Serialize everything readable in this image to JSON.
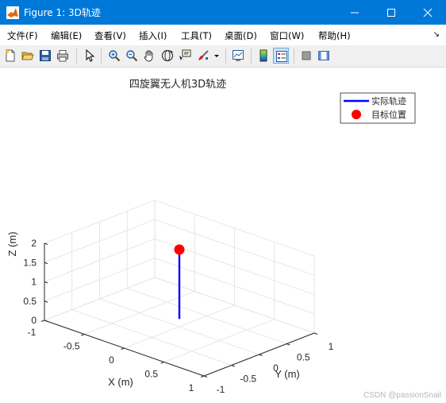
{
  "window": {
    "title": "Figure 1: 3D轨迹",
    "controls": [
      "minimize",
      "maximize",
      "close"
    ]
  },
  "menu": {
    "items": [
      "文件(F)",
      "编辑(E)",
      "查看(V)",
      "插入(I)",
      "工具(T)",
      "桌面(D)",
      "窗口(W)",
      "帮助(H)"
    ],
    "overflow_arrow": "↘"
  },
  "toolbar": {
    "buttons": [
      "new-figure",
      "open-file",
      "save",
      "print",
      "pointer",
      "zoom-in",
      "zoom-out",
      "pan",
      "rotate-3d",
      "data-cursor",
      "brush",
      "link-plot",
      "colorbar",
      "legend",
      "hide-plot-tools",
      "show-plot-tools"
    ],
    "active": "legend"
  },
  "chart_data": {
    "type": "line3d",
    "title": "四旋翼无人机3D轨迹",
    "xlabel": "X (m)",
    "ylabel": "Y (m)",
    "zlabel": "Z (m)",
    "xlim": [
      -1,
      1
    ],
    "ylim": [
      -1,
      1
    ],
    "zlim": [
      0,
      2
    ],
    "x_ticks": [
      "-1",
      "-0.5",
      "0",
      "0.5",
      "1"
    ],
    "y_ticks": [
      "-1",
      "-0.5",
      "0",
      "0.5",
      "1"
    ],
    "z_ticks": [
      "0",
      "0.5",
      "1",
      "1.5",
      "2"
    ],
    "grid": true,
    "legend_position": "top-right",
    "series": [
      {
        "name": "实际轨迹",
        "kind": "line",
        "color": "#0000ff",
        "x": [
          0,
          0
        ],
        "y": [
          0,
          0
        ],
        "z": [
          0.2,
          2.0
        ]
      },
      {
        "name": "目标位置",
        "kind": "marker",
        "color": "#ff0000",
        "x": [
          0
        ],
        "y": [
          0
        ],
        "z": [
          2.0
        ]
      }
    ]
  },
  "watermark": "CSDN @passionSnail"
}
